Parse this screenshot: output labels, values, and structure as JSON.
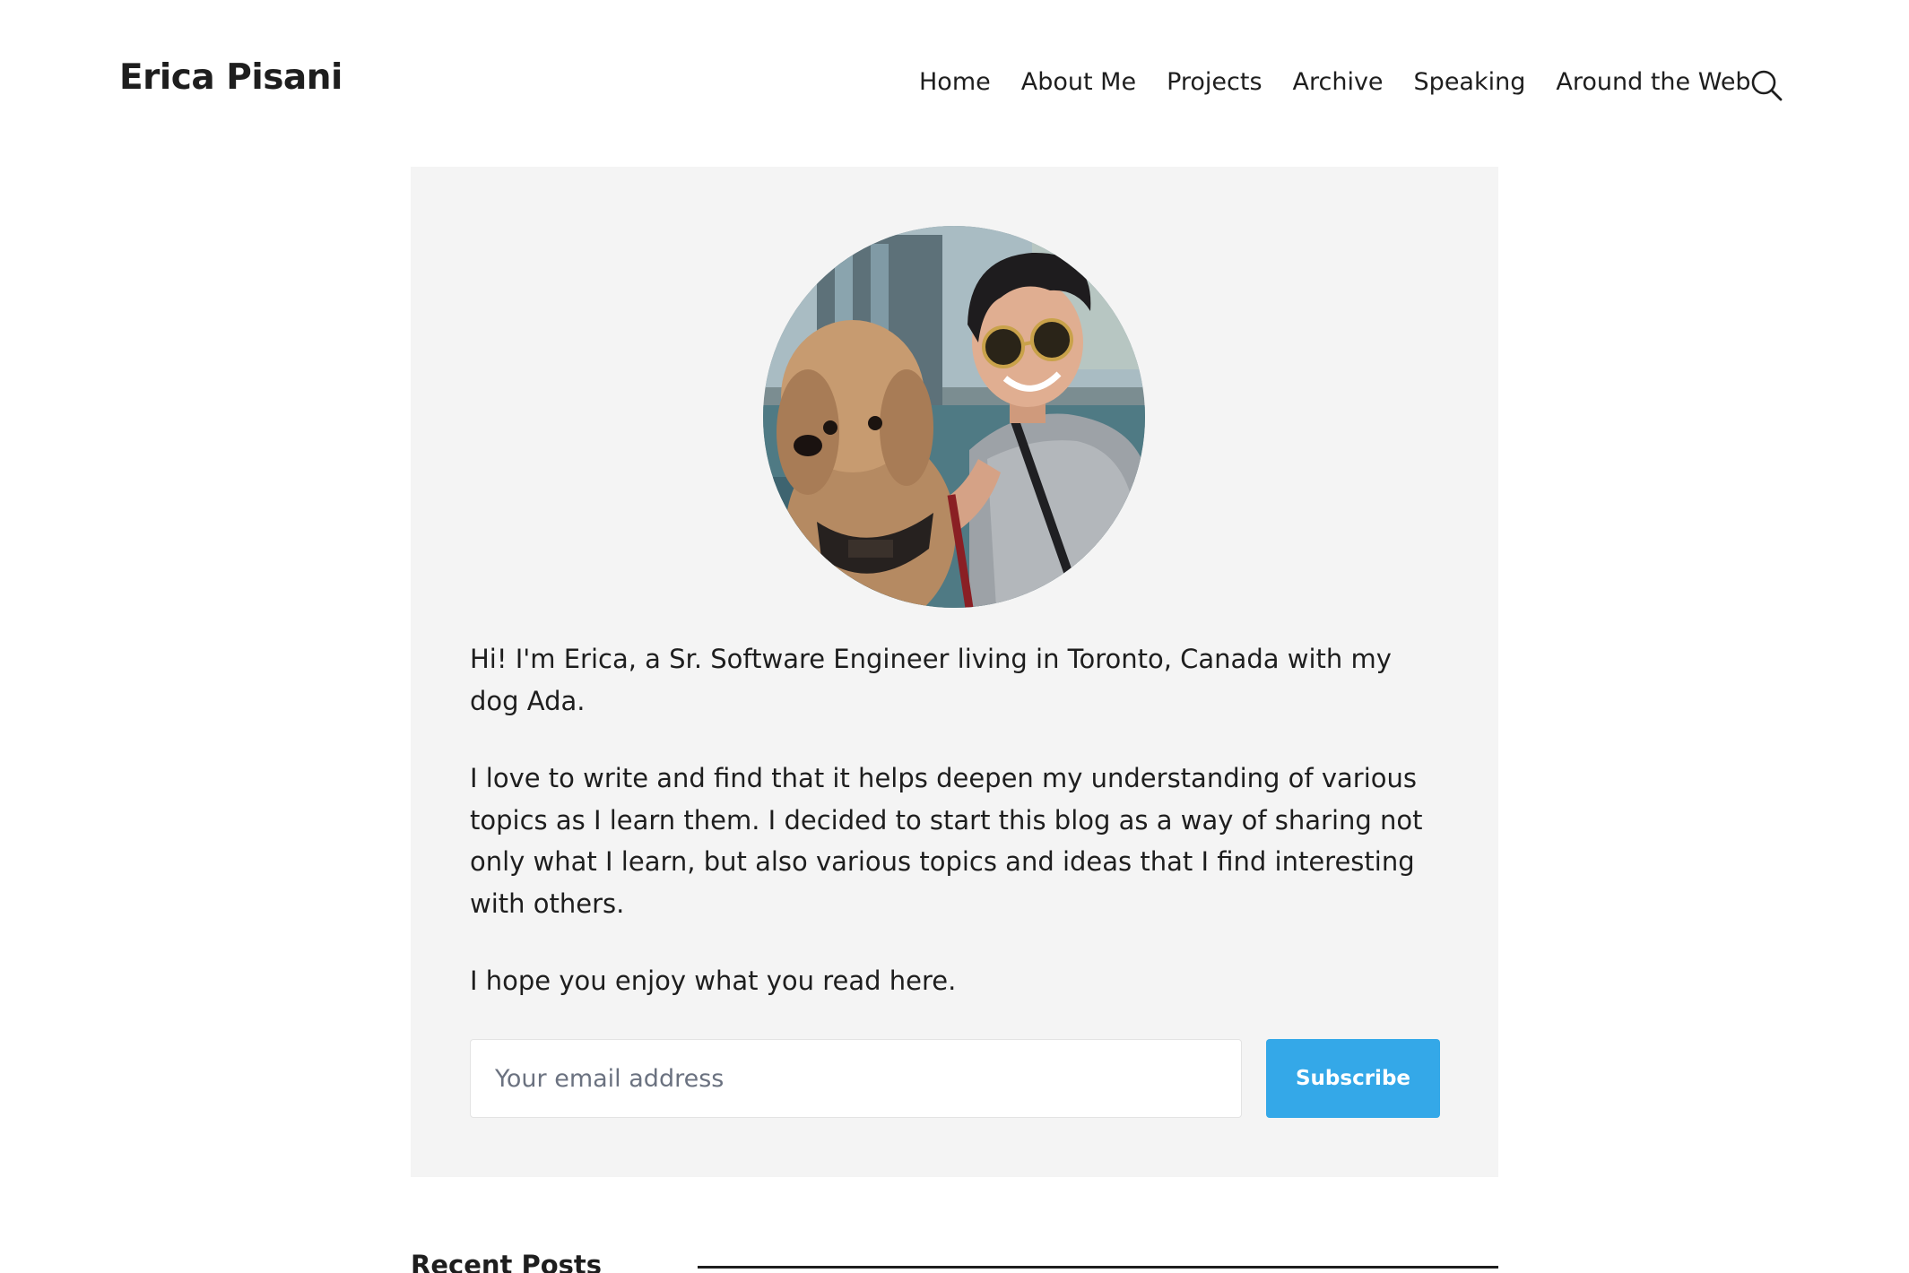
{
  "header": {
    "site_title": "Erica Pisani",
    "nav": [
      {
        "label": "Home"
      },
      {
        "label": "About Me"
      },
      {
        "label": "Projects"
      },
      {
        "label": "Archive"
      },
      {
        "label": "Speaking"
      },
      {
        "label": "Around the Web"
      }
    ],
    "search_icon": "search-icon"
  },
  "intro": {
    "avatar_icon": "profile-photo",
    "paragraphs": [
      "Hi! I'm Erica, a Sr. Software Engineer living in Toronto, Canada with my dog Ada.",
      "I love to write and find that it helps deepen my understanding of various topics as I learn them. I decided to start this blog as a way of sharing not only what I learn, but also various topics and ideas that I find interesting with others.",
      "I hope you enjoy what you read here."
    ],
    "subscribe": {
      "placeholder": "Your email address",
      "value": "",
      "button_label": "Subscribe"
    }
  },
  "recent_posts": {
    "heading": "Recent Posts"
  },
  "colors": {
    "card_background": "#f4f4f4",
    "accent": "#34a8e8",
    "text": "#1e1e1e"
  }
}
